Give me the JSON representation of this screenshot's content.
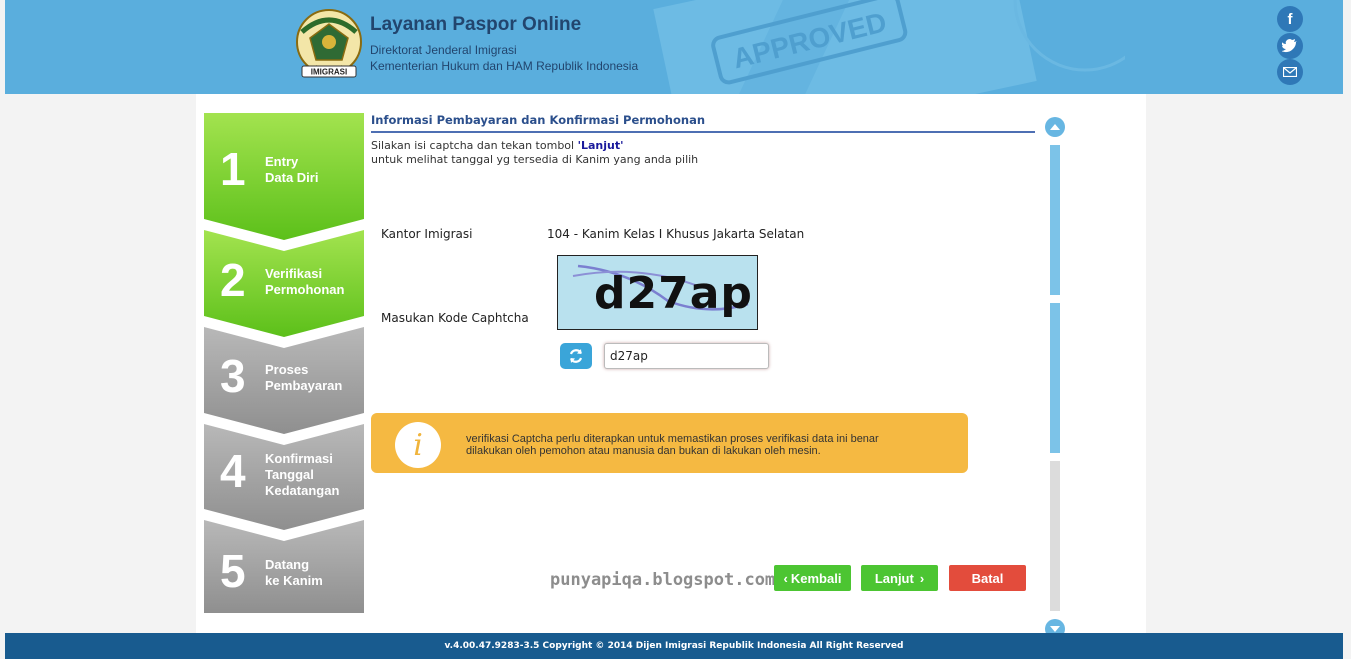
{
  "header": {
    "title": "Layanan Paspor Online",
    "subtitle_line1": "Direktorat Jenderal Imigrasi",
    "subtitle_line2": "Kementerian Hukum dan HAM Republik Indonesia",
    "logo_text": "IMIGRASI",
    "stamp_text": "APPROVED",
    "social": [
      "facebook-icon",
      "twitter-icon",
      "email-icon"
    ]
  },
  "steps": [
    {
      "number": "1",
      "line1": "Entry",
      "line2": "Data Diri",
      "line3": "",
      "state": "done"
    },
    {
      "number": "2",
      "line1": "Verifikasi",
      "line2": "Permohonan",
      "line3": "",
      "state": "active"
    },
    {
      "number": "3",
      "line1": "Proses",
      "line2": "Pembayaran",
      "line3": "",
      "state": "pending"
    },
    {
      "number": "4",
      "line1": "Konfirmasi",
      "line2": "Tanggal",
      "line3": "Kedatangan",
      "state": "pending"
    },
    {
      "number": "5",
      "line1": "Datang",
      "line2": "ke Kanim",
      "line3": "",
      "state": "pending"
    }
  ],
  "main": {
    "section_title": "Informasi Pembayaran dan Konfirmasi Permohonan",
    "instruction_prefix": "Silakan isi captcha dan tekan tombol ",
    "instruction_button": "'Lanjut'",
    "instruction_line2": "untuk melihat tanggal yg tersedia di Kanim yang anda pilih",
    "kantor_label": "Kantor Imigrasi",
    "kantor_value": "104 - Kanim Kelas I Khusus Jakarta Selatan",
    "captcha_label": "Masukan Kode Caphtcha",
    "captcha_image_text": "d27ap",
    "captcha_input_value": "d27ap",
    "info_line1": "verifikasi Captcha perlu diterapkan untuk memastikan proses verifikasi data ini benar",
    "info_line2": "dilakukan oleh pemohon atau manusia dan bukan di lakukan oleh mesin."
  },
  "buttons": {
    "back": "Kembali",
    "next": "Lanjut",
    "cancel": "Batal"
  },
  "watermark": "punyapiqa.blogspot.com",
  "footer": "v.4.00.47.9283-3.5 Copyright © 2014 Dijen Imigrasi Republik Indonesia All Right Reserved",
  "colors": {
    "header_bg": "#5aaedd",
    "step_done": "#7dd12a",
    "step_pending": "#a0a0a0",
    "info_bg": "#f5b942",
    "btn_green": "#4cc532",
    "btn_red": "#e34c3c",
    "footer_bg": "#185b8f"
  }
}
